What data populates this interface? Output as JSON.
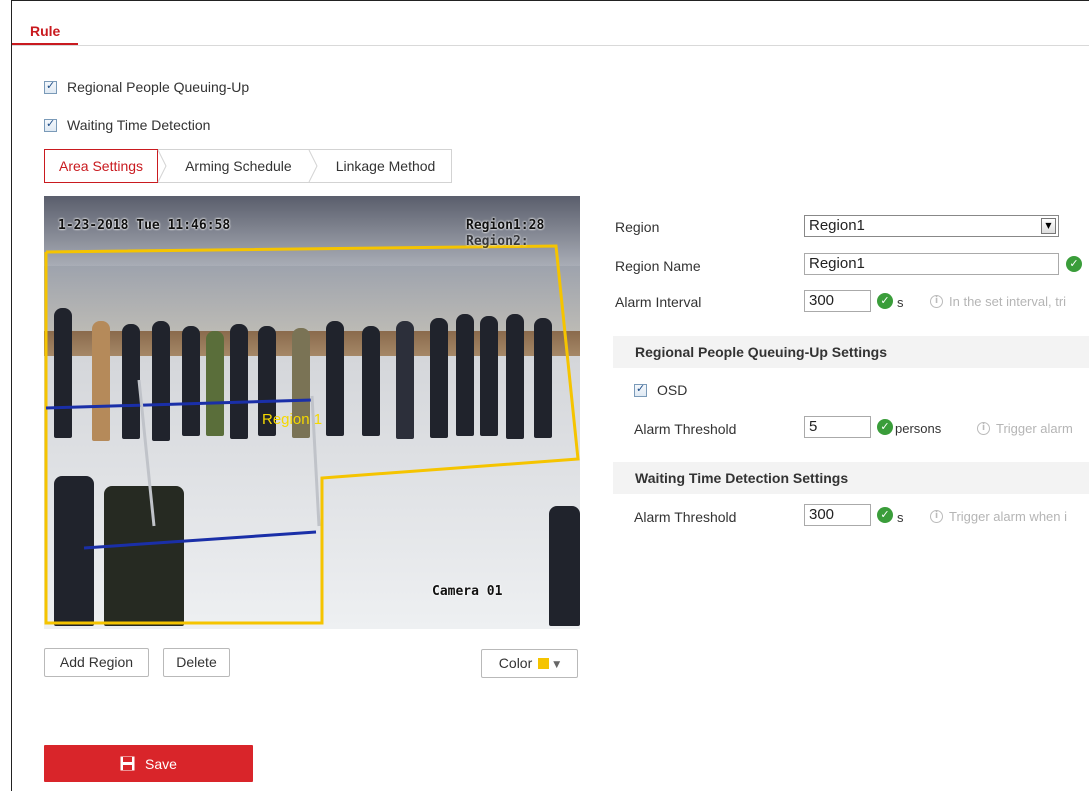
{
  "tabs": {
    "main": "Rule"
  },
  "options": {
    "queuing_label": "Regional People Queuing-Up",
    "queuing_checked": true,
    "waiting_label": "Waiting Time Detection",
    "waiting_checked": true
  },
  "subtabs": [
    "Area Settings",
    "Arming Schedule",
    "Linkage Method"
  ],
  "video": {
    "timestamp": "1-23-2018 Tue 11:46:58",
    "region1_osd": "Region1:28",
    "region2_osd": "Region2:",
    "region_label": "Region 1",
    "camera": "Camera 01",
    "region_color": "#f5c400"
  },
  "buttons": {
    "add_region": "Add Region",
    "delete": "Delete",
    "color": "Color",
    "save": "Save"
  },
  "settings": {
    "region_label": "Region",
    "region_value": "Region1",
    "region_name_label": "Region Name",
    "region_name_value": "Region1",
    "alarm_interval_label": "Alarm Interval",
    "alarm_interval_value": "300",
    "alarm_interval_unit": "s",
    "alarm_interval_hint": "In the set interval, tri"
  },
  "queuing_section": {
    "title": "Regional People Queuing-Up Settings",
    "osd_label": "OSD",
    "osd_checked": true,
    "threshold_label": "Alarm Threshold",
    "threshold_value": "5",
    "threshold_unit": "persons",
    "threshold_hint": "Trigger alarm"
  },
  "waiting_section": {
    "title": "Waiting Time Detection Settings",
    "threshold_label": "Alarm Threshold",
    "threshold_value": "300",
    "threshold_unit": "s",
    "threshold_hint": "Trigger alarm when i"
  }
}
